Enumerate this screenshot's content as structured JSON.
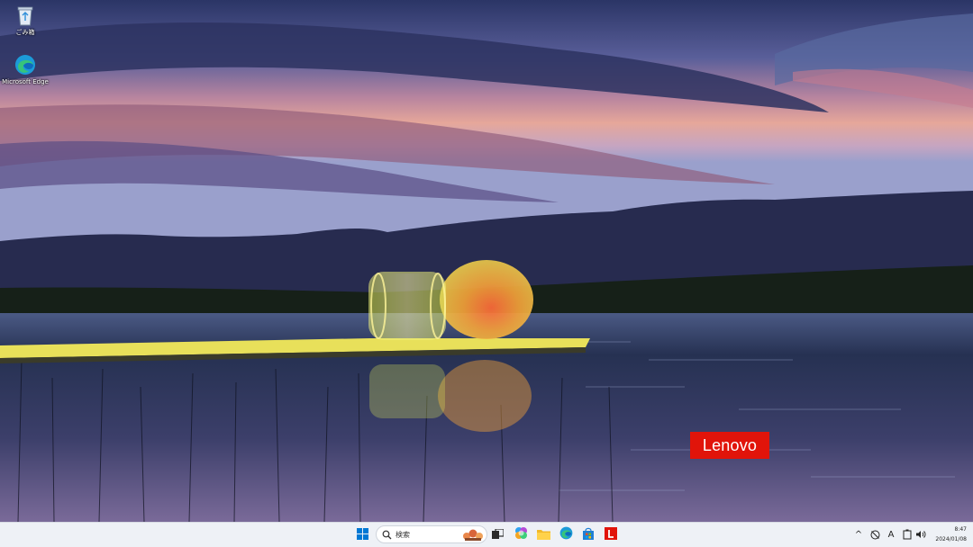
{
  "desktop": {
    "icons": [
      {
        "label": "ごみ箱",
        "icon": "recycle-bin-icon"
      },
      {
        "label": "Microsoft Edge",
        "icon": "edge-icon"
      }
    ]
  },
  "wallpaper": {
    "brand_badge": "Lenovo"
  },
  "taskbar": {
    "search_placeholder": "検索",
    "apps": [
      {
        "name": "start-button",
        "icon": "windows-logo-icon"
      },
      {
        "name": "task-view-button",
        "icon": "task-view-icon"
      },
      {
        "name": "copilot-button",
        "icon": "copilot-icon"
      },
      {
        "name": "file-explorer-button",
        "icon": "folder-icon"
      },
      {
        "name": "edge-button",
        "icon": "edge-icon"
      },
      {
        "name": "store-button",
        "icon": "store-icon"
      },
      {
        "name": "lenovo-app-button",
        "icon": "lenovo-l-icon"
      }
    ],
    "tray": {
      "chevron": "^",
      "ime": "A",
      "time": "8:47",
      "date": "2024/01/08"
    }
  },
  "colors": {
    "taskbar_bg": "#eef1f6",
    "lenovo_red": "#e1140a",
    "windows_blue": "#0078d4"
  }
}
